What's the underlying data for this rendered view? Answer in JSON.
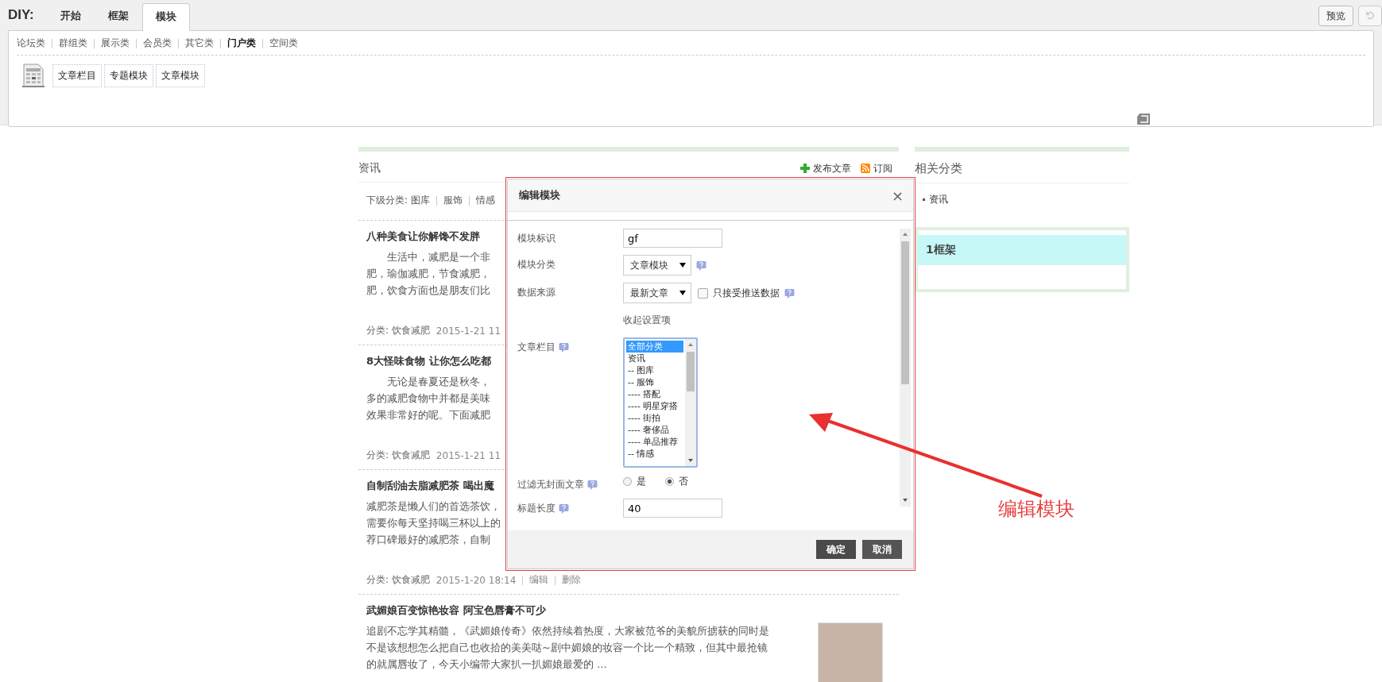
{
  "toolbar": {
    "title": "DIY:",
    "tabs": [
      {
        "label": "开始",
        "selected": false
      },
      {
        "label": "框架",
        "selected": false
      },
      {
        "label": "模块",
        "selected": true
      }
    ],
    "preview_button": "预览"
  },
  "module_panel": {
    "categories": [
      {
        "label": "论坛类",
        "selected": false
      },
      {
        "label": "群组类",
        "selected": false
      },
      {
        "label": "展示类",
        "selected": false
      },
      {
        "label": "会员类",
        "selected": false
      },
      {
        "label": "其它类",
        "selected": false
      },
      {
        "label": "门户类",
        "selected": true
      },
      {
        "label": "空间类",
        "selected": false
      }
    ],
    "modules": [
      "文章栏目",
      "专题模块",
      "文章模块"
    ]
  },
  "main": {
    "heading": "资讯",
    "actions": [
      {
        "kind": "add",
        "label": "发布文章"
      },
      {
        "kind": "rss",
        "label": "订阅"
      }
    ],
    "subcategory_label": "下级分类:",
    "subcategories": [
      "图库",
      "服饰",
      "情感"
    ],
    "articles": [
      {
        "title": "八种美食让你解馋不发胖",
        "lines": [
          "　　生活中，减肥是一个非",
          "肥，瑜伽减肥，节食减肥，",
          "肥，饮食方面也是朋友们比"
        ],
        "category": "分类: 饮食减肥",
        "date": "2015-1-21 11",
        "photo": false
      },
      {
        "title": "8大怪味食物 让你怎么吃都",
        "lines": [
          "　　无论是春夏还是秋冬，",
          "多的减肥食物中并都是美味",
          "效果非常好的呢。下面减肥"
        ],
        "category": "分类: 饮食减肥",
        "date": "2015-1-21 11",
        "photo": false
      },
      {
        "title": "自制刮油去脂减肥茶 喝出魔",
        "lines": [
          "减肥茶是懒人们的首选茶饮，",
          "需要你每天坚持喝三杯以上的",
          "荐口碑最好的减肥茶，自制"
        ],
        "category": "分类: 饮食减肥",
        "date": "2015-1-20 18:14",
        "links": [
          "编辑",
          "删除"
        ],
        "photo": false
      },
      {
        "title": "武媚娘百变惊艳妆容 阿宝色唇膏不可少",
        "lines": [
          "追剧不忘学其精髓，《武媚娘传奇》依然持续着热度，大家被范爷的美貌所掳获的同时是",
          "不是该想想怎么把自己也收拾的美美哒~剧中媚娘的妆容一个比一个精致，但其中最抢镜",
          "的就属唇妆了，今天小编带大家扒一扒媚娘最爱的 ..."
        ],
        "photo": true
      }
    ]
  },
  "sidebar": {
    "heading": "相关分类",
    "items": [
      "资讯"
    ],
    "frame_title": "1框架"
  },
  "dialog": {
    "title": "编辑模块",
    "close": "×",
    "rows": [
      {
        "kind": "text",
        "label": "模块标识",
        "value": "gf",
        "help": false
      },
      {
        "kind": "select",
        "label": "模块分类",
        "value": "文章模块",
        "help": true
      },
      {
        "kind": "select",
        "label": "数据来源",
        "value": "最新文章",
        "help": true,
        "checkbox": {
          "label": "只接受推送数据",
          "checked": false
        }
      },
      {
        "kind": "link",
        "value": "收起设置项"
      },
      {
        "kind": "listbox",
        "label": "文章栏目",
        "help": true,
        "options": [
          {
            "label": "全部分类",
            "selected": true
          },
          {
            "label": "资讯",
            "selected": false
          },
          {
            "label": "-- 图库",
            "selected": false
          },
          {
            "label": "-- 服饰",
            "selected": false
          },
          {
            "label": "---- 搭配",
            "selected": false
          },
          {
            "label": "---- 明星穿搭",
            "selected": false
          },
          {
            "label": "---- 街拍",
            "selected": false
          },
          {
            "label": "---- 奢侈品",
            "selected": false
          },
          {
            "label": "---- 单品推荐",
            "selected": false
          },
          {
            "label": "-- 情感",
            "selected": false
          }
        ]
      },
      {
        "kind": "radio",
        "label": "过滤无封面文章",
        "help": true,
        "options": [
          {
            "label": "是",
            "selected": false
          },
          {
            "label": "否",
            "selected": true
          }
        ]
      },
      {
        "kind": "text",
        "label": "标题长度",
        "value": "40",
        "help": true
      }
    ],
    "buttons": [
      {
        "kind": "primary",
        "label": "确定"
      },
      {
        "kind": "cancel",
        "label": "取消"
      }
    ]
  },
  "annotation": {
    "text": "编辑模块"
  }
}
